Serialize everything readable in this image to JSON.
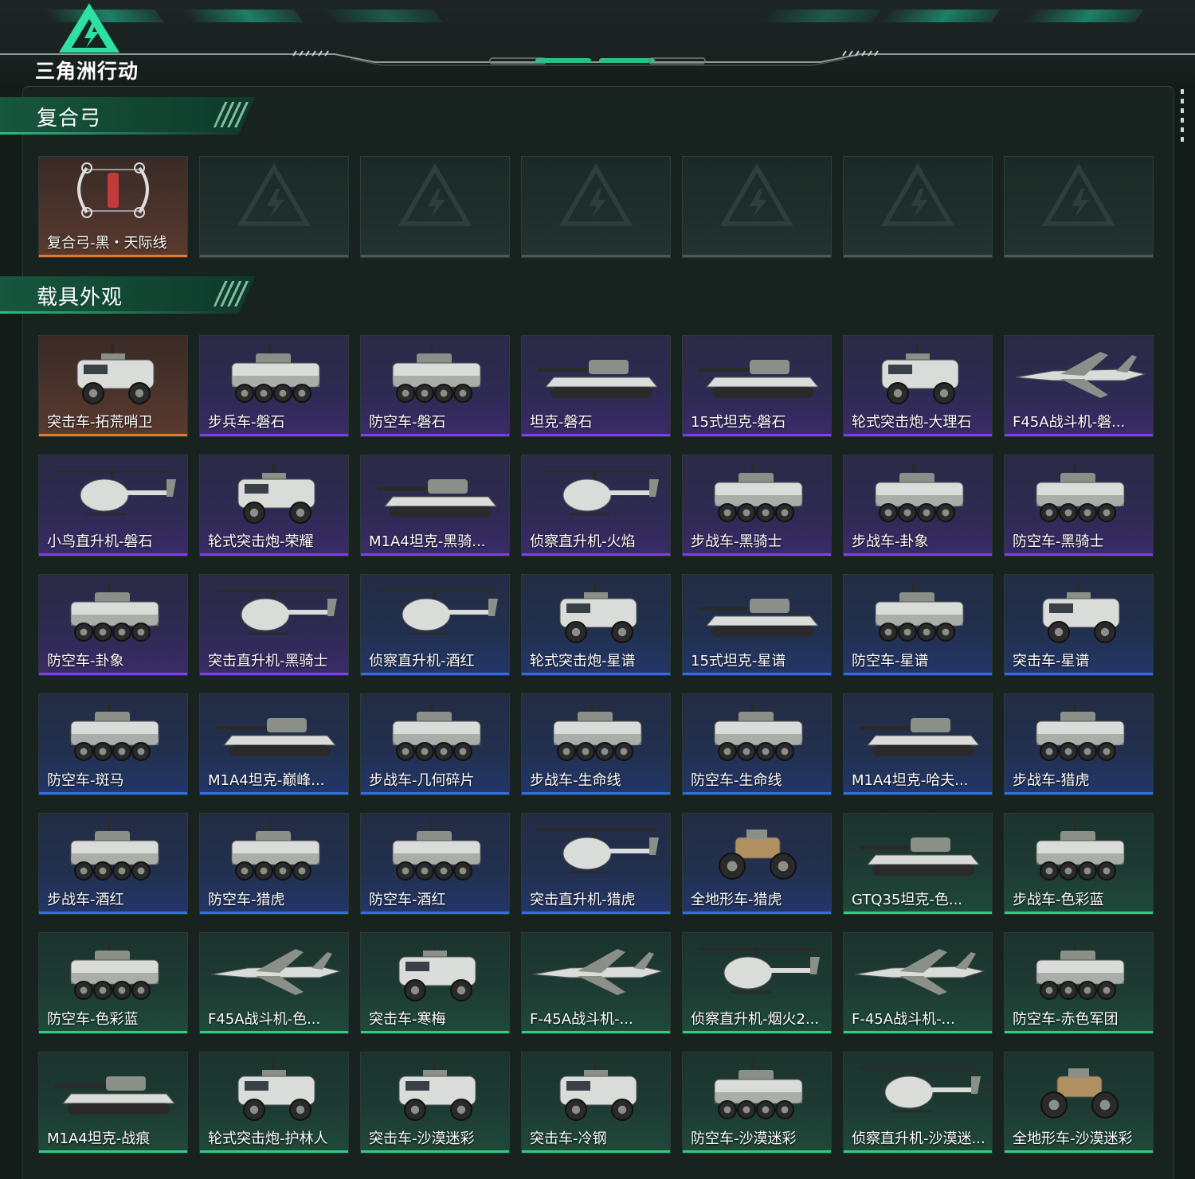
{
  "brand": {
    "logo_text": "三角洲行动"
  },
  "colors": {
    "gold": "#e07a2e",
    "purple": "#7e3df0",
    "blue": "#2f6ee6",
    "green": "#2bd07f",
    "accent": "#2bbf84"
  },
  "sections": [
    {
      "title": "复合弓",
      "items": [
        {
          "label": "复合弓-黑・天际线",
          "rarity": "gold",
          "kind": "bow"
        },
        {
          "label": "",
          "rarity": "empty",
          "kind": "empty"
        },
        {
          "label": "",
          "rarity": "empty",
          "kind": "empty"
        },
        {
          "label": "",
          "rarity": "empty",
          "kind": "empty"
        },
        {
          "label": "",
          "rarity": "empty",
          "kind": "empty"
        },
        {
          "label": "",
          "rarity": "empty",
          "kind": "empty"
        },
        {
          "label": "",
          "rarity": "empty",
          "kind": "empty"
        }
      ]
    },
    {
      "title": "载具外观",
      "items": [
        {
          "label": "突击车-拓荒哨卫",
          "rarity": "gold",
          "kind": "truck"
        },
        {
          "label": "步兵车-磐石",
          "rarity": "purple",
          "kind": "apc"
        },
        {
          "label": "防空车-磐石",
          "rarity": "purple",
          "kind": "apc"
        },
        {
          "label": "坦克-磐石",
          "rarity": "purple",
          "kind": "tank"
        },
        {
          "label": "15式坦克-磐石",
          "rarity": "purple",
          "kind": "tank"
        },
        {
          "label": "轮式突击炮-大理石",
          "rarity": "purple",
          "kind": "truck"
        },
        {
          "label": "F45A战斗机-磐...",
          "rarity": "purple",
          "kind": "jet"
        },
        {
          "label": "小鸟直升机-磐石",
          "rarity": "purple",
          "kind": "heli"
        },
        {
          "label": "轮式突击炮-荣耀",
          "rarity": "purple",
          "kind": "truck"
        },
        {
          "label": "M1A4坦克-黑骑...",
          "rarity": "purple",
          "kind": "tank"
        },
        {
          "label": "侦察直升机-火焰",
          "rarity": "purple",
          "kind": "heli"
        },
        {
          "label": "步战车-黑骑士",
          "rarity": "purple",
          "kind": "apc"
        },
        {
          "label": "步战车-卦象",
          "rarity": "purple",
          "kind": "apc"
        },
        {
          "label": "防空车-黑骑士",
          "rarity": "purple",
          "kind": "apc"
        },
        {
          "label": "防空车-卦象",
          "rarity": "purple",
          "kind": "apc"
        },
        {
          "label": "突击直升机-黑骑士",
          "rarity": "purple",
          "kind": "heli"
        },
        {
          "label": "侦察直升机-酒红",
          "rarity": "blue",
          "kind": "heli"
        },
        {
          "label": "轮式突击炮-星谱",
          "rarity": "blue",
          "kind": "truck"
        },
        {
          "label": "15式坦克-星谱",
          "rarity": "blue",
          "kind": "tank"
        },
        {
          "label": "防空车-星谱",
          "rarity": "blue",
          "kind": "apc"
        },
        {
          "label": "突击车-星谱",
          "rarity": "blue",
          "kind": "truck"
        },
        {
          "label": "防空车-斑马",
          "rarity": "blue",
          "kind": "apc"
        },
        {
          "label": "M1A4坦克-巅峰...",
          "rarity": "blue",
          "kind": "tank"
        },
        {
          "label": "步战车-几何碎片",
          "rarity": "blue",
          "kind": "apc"
        },
        {
          "label": "步战车-生命线",
          "rarity": "blue",
          "kind": "apc"
        },
        {
          "label": "防空车-生命线",
          "rarity": "blue",
          "kind": "apc"
        },
        {
          "label": "M1A4坦克-哈夫...",
          "rarity": "blue",
          "kind": "tank"
        },
        {
          "label": "步战车-猎虎",
          "rarity": "blue",
          "kind": "apc"
        },
        {
          "label": "步战车-酒红",
          "rarity": "blue",
          "kind": "apc"
        },
        {
          "label": "防空车-猎虎",
          "rarity": "blue",
          "kind": "apc"
        },
        {
          "label": "防空车-酒红",
          "rarity": "blue",
          "kind": "apc"
        },
        {
          "label": "突击直升机-猎虎",
          "rarity": "blue",
          "kind": "heli"
        },
        {
          "label": "全地形车-猎虎",
          "rarity": "blue",
          "kind": "atv"
        },
        {
          "label": "GTQ35坦克-色...",
          "rarity": "green",
          "kind": "tank"
        },
        {
          "label": "步战车-色彩蓝",
          "rarity": "green",
          "kind": "apc"
        },
        {
          "label": "防空车-色彩蓝",
          "rarity": "green",
          "kind": "apc"
        },
        {
          "label": "F45A战斗机-色...",
          "rarity": "green",
          "kind": "jet"
        },
        {
          "label": "突击车-寒梅",
          "rarity": "green",
          "kind": "truck"
        },
        {
          "label": "F-45A战斗机-...",
          "rarity": "green",
          "kind": "jet"
        },
        {
          "label": "侦察直升机-烟火2...",
          "rarity": "green",
          "kind": "heli"
        },
        {
          "label": "F-45A战斗机-...",
          "rarity": "green",
          "kind": "jet"
        },
        {
          "label": "防空车-赤色军团",
          "rarity": "green",
          "kind": "apc"
        },
        {
          "label": "M1A4坦克-战痕",
          "rarity": "green",
          "kind": "tank"
        },
        {
          "label": "轮式突击炮-护林人",
          "rarity": "green",
          "kind": "truck"
        },
        {
          "label": "突击车-沙漠迷彩",
          "rarity": "green",
          "kind": "truck"
        },
        {
          "label": "突击车-冷钢",
          "rarity": "green",
          "kind": "truck"
        },
        {
          "label": "防空车-沙漠迷彩",
          "rarity": "green",
          "kind": "apc"
        },
        {
          "label": "侦察直升机-沙漠迷...",
          "rarity": "green",
          "kind": "heli"
        },
        {
          "label": "全地形车-沙漠迷彩",
          "rarity": "green",
          "kind": "atv"
        }
      ]
    }
  ]
}
